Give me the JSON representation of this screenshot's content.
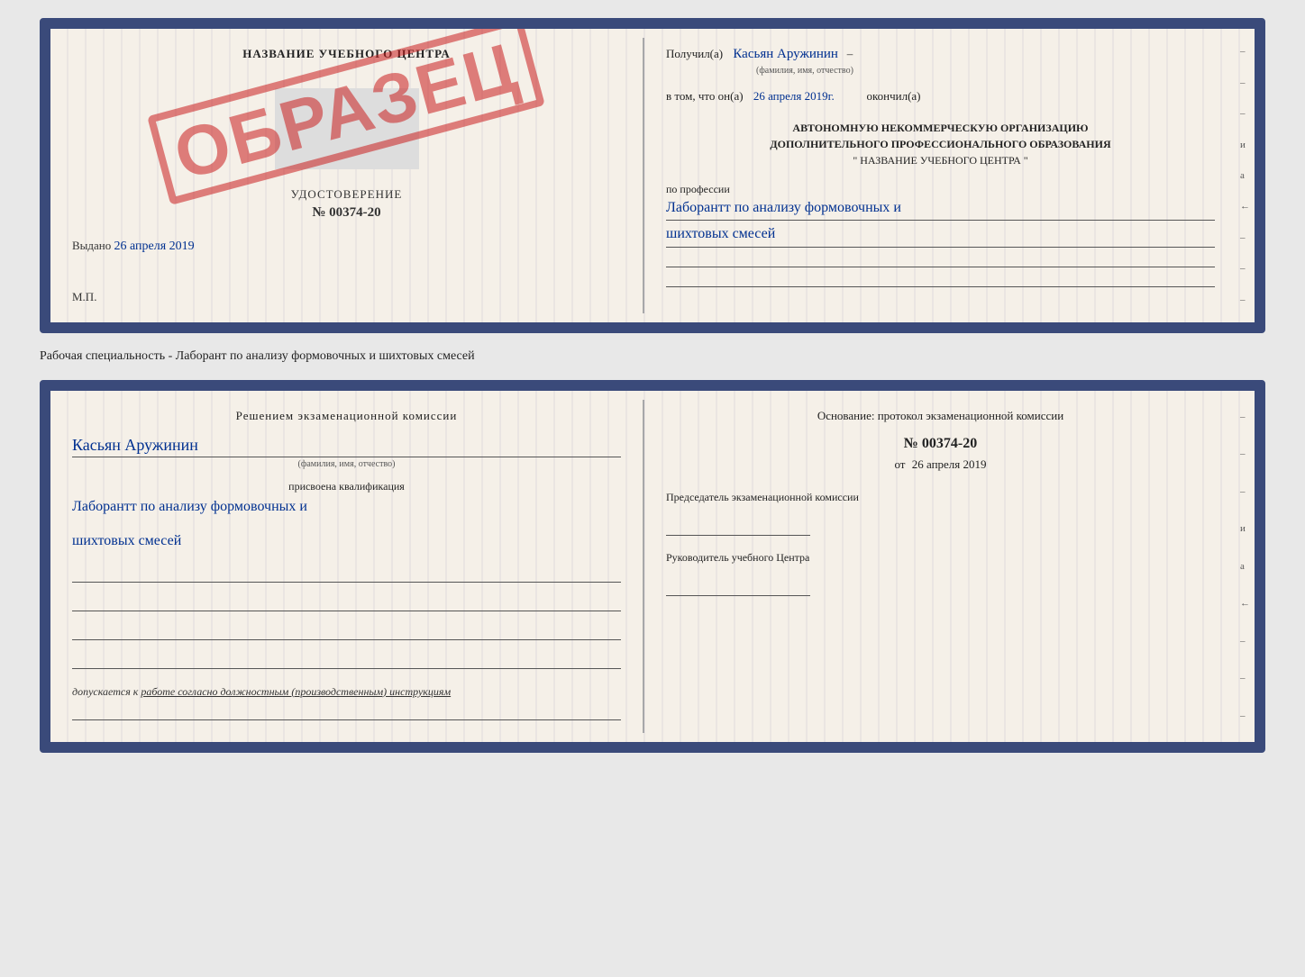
{
  "top_doc": {
    "left": {
      "title": "НАЗВАНИЕ УЧЕБНОГО ЦЕНТРА",
      "cert_type": "УДОСТОВЕРЕНИЕ",
      "cert_number": "№ 00374-20",
      "vydano_label": "Выдано",
      "vydano_date": "26 апреля 2019",
      "mp_label": "М.П.",
      "stamp": "ОБРАЗЕЦ"
    },
    "right": {
      "received_label": "Получил(а)",
      "received_name": "Касьян Аружинин",
      "name_sublabel": "(фамилия, имя, отчество)",
      "vtom_label": "в том, что он(а)",
      "vtom_date": "26 апреля 2019г.",
      "okonchil_label": "окончил(а)",
      "org_line1": "АВТОНОМНУЮ НЕКОММЕРЧЕСКУЮ ОРГАНИЗАЦИЮ",
      "org_line2": "ДОПОЛНИТЕЛЬНОГО ПРОФЕССИОНАЛЬНОГО ОБРАЗОВАНИЯ",
      "org_line3": "\"  НАЗВАНИЕ УЧЕБНОГО ЦЕНТРА  \"",
      "prof_label": "по профессии",
      "prof_value_line1": "Лаборантт по анализу формовочных и",
      "prof_value_line2": "шихтовых смесей"
    }
  },
  "specialty_line": "Рабочая специальность - Лаборант по анализу формовочных и шихтовых смесей",
  "bottom_doc": {
    "left": {
      "decision_label": "Решением экзаменационной комиссии",
      "person_name": "Касьян Аружинин",
      "name_sublabel": "(фамилия, имя, отчество)",
      "qualification_label": "присвоена квалификация",
      "qualification_value_line1": "Лаборантт по анализу формовочных и",
      "qualification_value_line2": "шихтовых смесей",
      "admission_text": "допускается к работе согласно должностным (производственным) инструкциям"
    },
    "right": {
      "osnov_label": "Основание: протокол экзаменационной комиссии",
      "protocol_number": "№ 00374-20",
      "protocol_date_prefix": "от",
      "protocol_date": "26 апреля 2019",
      "chairman_label": "Председатель экзаменационной комиссии",
      "head_label": "Руководитель учебного Центра"
    }
  },
  "side_marks": {
    "right": [
      "–",
      "–",
      "–",
      "и",
      "а",
      "←",
      "–",
      "–",
      "–"
    ]
  }
}
